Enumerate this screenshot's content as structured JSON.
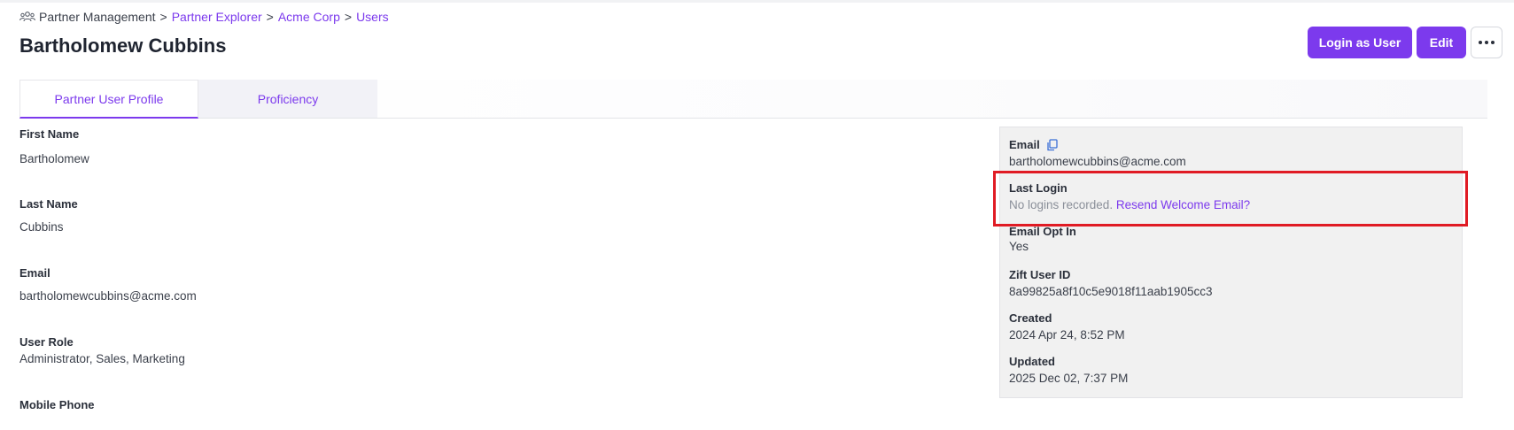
{
  "breadcrumb": {
    "icon": "users-group-icon",
    "items": [
      "Partner Management",
      "Partner Explorer",
      "Acme Corp",
      "Users"
    ],
    "separator": ">"
  },
  "page": {
    "title": "Bartholomew Cubbins"
  },
  "actions": {
    "login_label": "Login as User",
    "edit_label": "Edit",
    "more_icon": "more-horizontal-icon"
  },
  "tabs": [
    {
      "label": "Partner User Profile",
      "active": true
    },
    {
      "label": "Proficiency",
      "active": false
    }
  ],
  "profile": {
    "first_name": {
      "label": "First Name",
      "value": "Bartholomew"
    },
    "last_name": {
      "label": "Last Name",
      "value": "Cubbins"
    },
    "email": {
      "label": "Email",
      "value": "bartholomewcubbins@acme.com"
    },
    "user_role": {
      "label": "User Role",
      "value": "Administrator, Sales, Marketing"
    },
    "mobile_phone": {
      "label": "Mobile Phone"
    }
  },
  "info": {
    "email": {
      "label": "Email",
      "value": "bartholomewcubbins@acme.com",
      "icon": "copy-icon"
    },
    "last_login": {
      "label": "Last Login",
      "value": "No logins recorded.",
      "link": "Resend Welcome Email?"
    },
    "email_opt_in": {
      "label": "Email Opt In",
      "value": "Yes"
    },
    "zift_user_id": {
      "label": "Zift User ID",
      "value": "8a99825a8f10c5e9018f11aab1905cc3"
    },
    "created": {
      "label": "Created",
      "value": "2024 Apr 24, 8:52 PM"
    },
    "updated": {
      "label": "Updated",
      "value": "2025 Dec 02, 7:37 PM"
    }
  },
  "colors": {
    "accent": "#7c3aed",
    "highlight": "#e01b24",
    "panel": "#f1f1f1"
  }
}
